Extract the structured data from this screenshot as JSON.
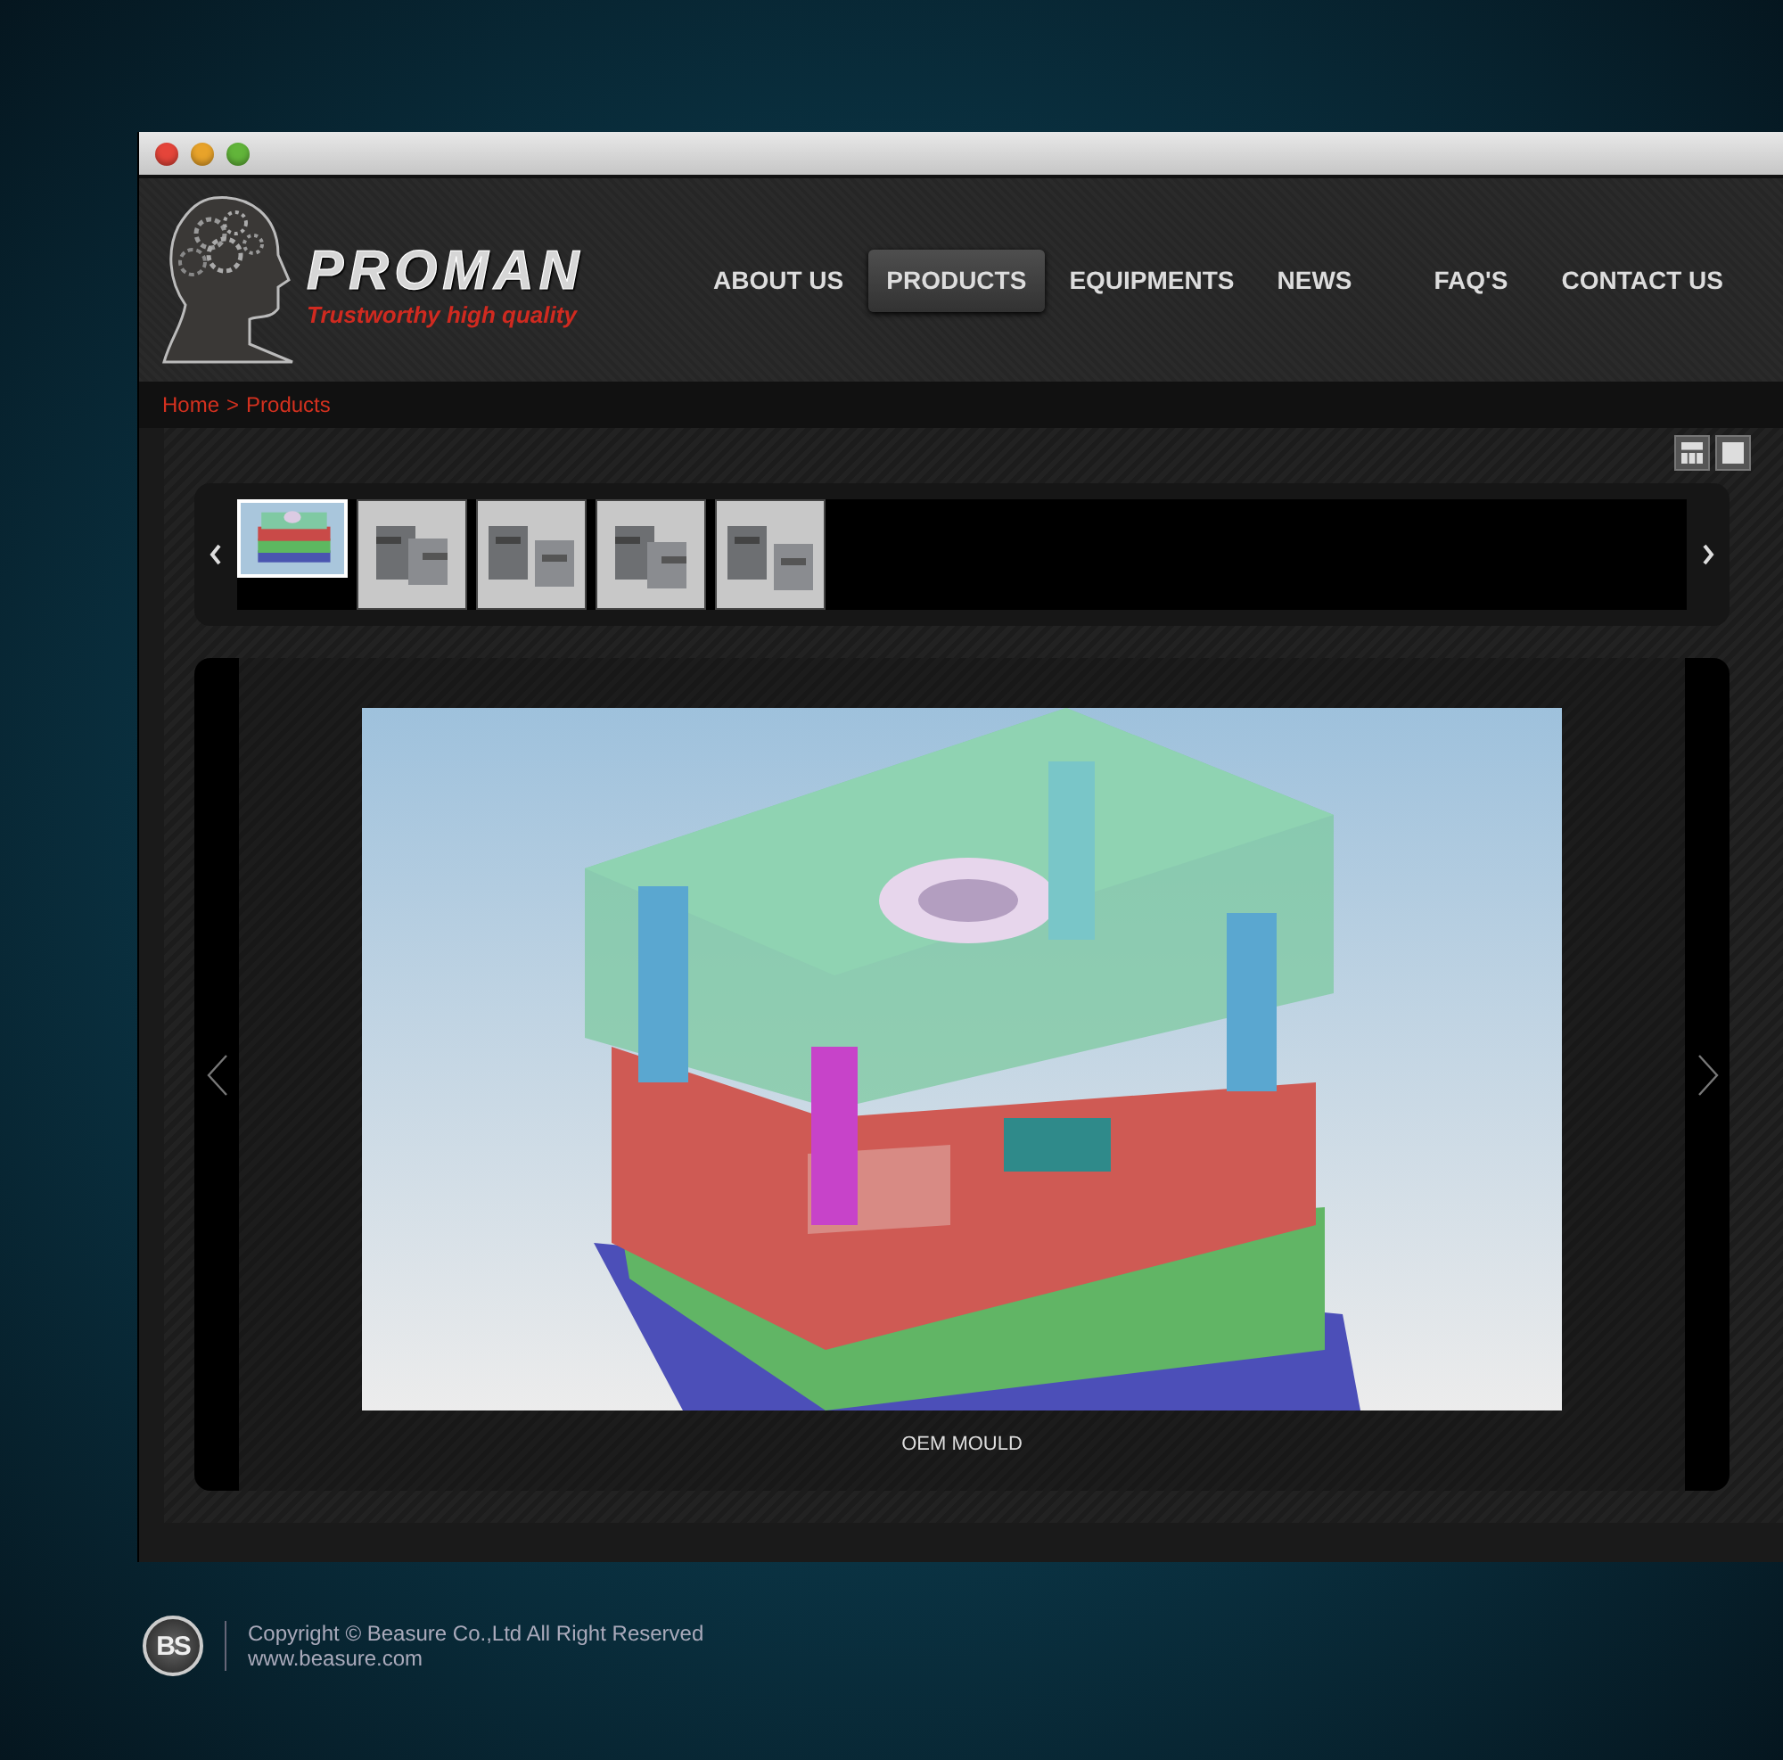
{
  "window": {
    "controls": [
      {
        "kind": "close"
      },
      {
        "kind": "minimize"
      },
      {
        "kind": "zoom"
      }
    ]
  },
  "logo": {
    "name": "PROMAN",
    "tagline": "Trustworthy high quality"
  },
  "nav": [
    {
      "label": "ABOUT US",
      "selected": false
    },
    {
      "label": "PRODUCTS",
      "selected": true
    },
    {
      "label": "EQUIPMENTS",
      "selected": false
    },
    {
      "label": "NEWS",
      "selected": false
    },
    {
      "label": "FAQ'S",
      "selected": false
    },
    {
      "label": "CONTACT US",
      "selected": false
    }
  ],
  "breadcrumb": {
    "home": "Home",
    "separator": ">",
    "current": "Products"
  },
  "view_toggle": [
    {
      "kind": "grid"
    },
    {
      "kind": "single"
    }
  ],
  "thumbnails": [
    {
      "kind": "picture",
      "selected": true
    },
    {
      "kind": "picture",
      "selected": false
    },
    {
      "kind": "picture",
      "selected": false
    },
    {
      "kind": "picture",
      "selected": false
    },
    {
      "kind": "picture",
      "selected": false
    }
  ],
  "gallery": {
    "caption": "OEM MOULD"
  },
  "footer": {
    "logo": "BS",
    "copyright": "Copyright © Beasure Co.,Ltd All Right Reserved",
    "url": "www.beasure.com"
  }
}
